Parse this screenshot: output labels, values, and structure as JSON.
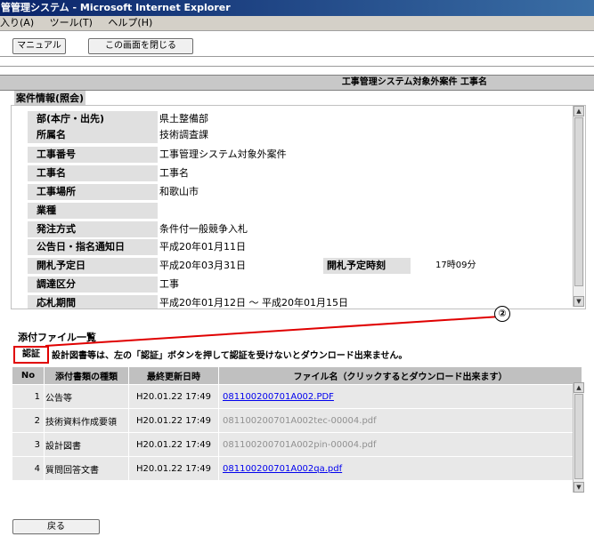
{
  "window": {
    "title": "管管理システム - Microsoft Internet Explorer"
  },
  "menu": {
    "items": [
      "入り(A)",
      "ツール(T)",
      "ヘルプ(H)"
    ]
  },
  "toolbar": {
    "manual_label": "マニュアル",
    "close_label": "この画面を閉じる"
  },
  "header": {
    "title": "工事管理システム対象外案件 工事名"
  },
  "case_info": {
    "title": "案件情報(照会)",
    "rows": [
      {
        "label": "部(本庁・出先)",
        "value": "県土整備部"
      },
      {
        "label": "所属名",
        "value": "技術調査課"
      },
      {
        "label": "工事番号",
        "value": "工事管理システム対象外案件"
      },
      {
        "label": "工事名",
        "value": "工事名"
      },
      {
        "label": "工事場所",
        "value": "和歌山市"
      },
      {
        "label": "業種",
        "value": ""
      },
      {
        "label": "発注方式",
        "value": "条件付一般競争入札"
      },
      {
        "label": "公告日・指名通知日",
        "value": "平成20年01月11日"
      },
      {
        "label": "開札予定日",
        "value": "平成20年03月31日",
        "label2": "開札予定時刻",
        "value2": "17時09分"
      },
      {
        "label": "調達区分",
        "value": "工事"
      },
      {
        "label": "応札期間",
        "value": "平成20年01月12日 ～ 平成20年01月15日"
      }
    ]
  },
  "attachments": {
    "title": "添付ファイル一覧",
    "cert_label": "認証",
    "notice": "設計図書等は、左の「認証」ボタンを押して認証を受けないとダウンロード出来ません。",
    "annotation": "②",
    "columns": [
      "No",
      "添付書類の種類",
      "最終更新日時",
      "ファイル名（クリックするとダウンロード出来ます）"
    ],
    "rows": [
      {
        "no": "1",
        "kind": "公告等",
        "updated": "H20.01.22 17:49",
        "file": "081100200701A002.PDF",
        "link": true
      },
      {
        "no": "2",
        "kind": "技術資料作成要領",
        "updated": "H20.01.22 17:49",
        "file": "081100200701A002tec-00004.pdf",
        "link": false
      },
      {
        "no": "3",
        "kind": "設計図書",
        "updated": "H20.01.22 17:49",
        "file": "081100200701A002pin-00004.pdf",
        "link": false
      },
      {
        "no": "4",
        "kind": "質問回答文書",
        "updated": "H20.01.22 17:49",
        "file": "081100200701A002qa.pdf",
        "link": true
      }
    ]
  },
  "footer": {
    "back_label": "戻る"
  },
  "colors": {
    "highlight": "#e00000",
    "link": "#0000ee",
    "disabled_text": "#909090"
  }
}
